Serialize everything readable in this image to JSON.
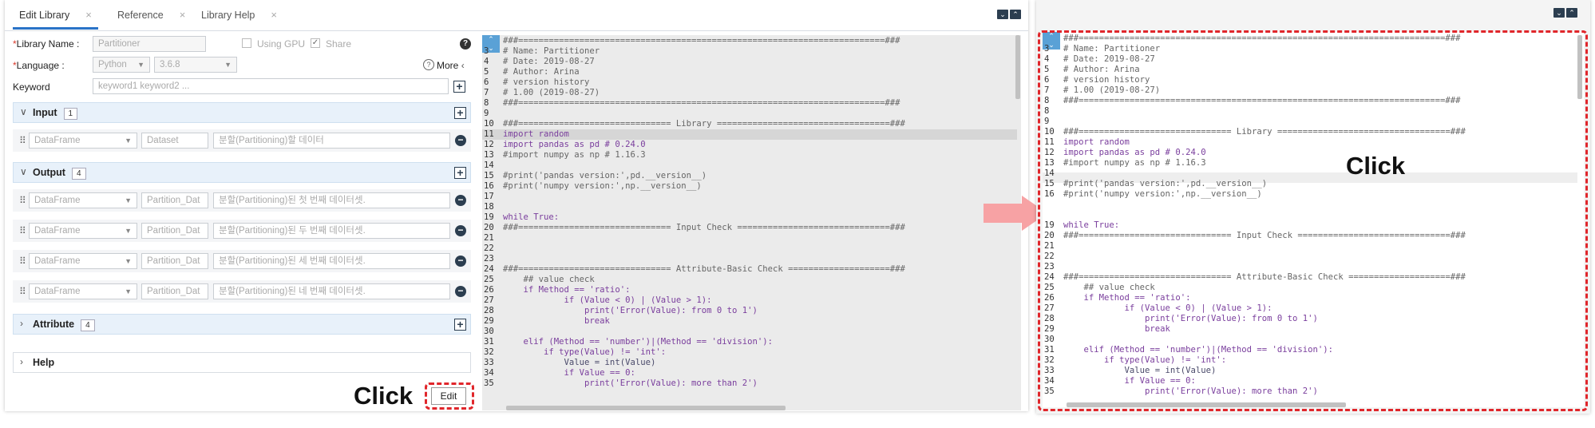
{
  "tabs": [
    {
      "label": "Edit Library"
    },
    {
      "label": "Reference"
    },
    {
      "label": "Library Help"
    }
  ],
  "tab_close": "×",
  "form": {
    "library_name_label": "Library Name :",
    "library_name_placeholder": "Partitioner",
    "using_gpu_label": "Using GPU",
    "share_label": "Share",
    "language_label": "Language :",
    "language_value": "Python",
    "version_value": "3.6.8",
    "more_label": "More",
    "keyword_label": "Keyword",
    "keyword_placeholder": "keyword1 keyword2 ..."
  },
  "sections": {
    "input": {
      "title": "Input",
      "count": "1"
    },
    "output": {
      "title": "Output",
      "count": "4"
    },
    "attribute": {
      "title": "Attribute",
      "count": "4"
    },
    "help": {
      "title": "Help"
    }
  },
  "input_rows": [
    {
      "type": "DataFrame",
      "name": "Dataset",
      "desc": "분할(Partitioning)할 데이터"
    }
  ],
  "output_rows": [
    {
      "type": "DataFrame",
      "name": "Partition_Dat",
      "desc": "분할(Partitioning)된 첫 번째 데이터셋."
    },
    {
      "type": "DataFrame",
      "name": "Partition_Dat",
      "desc": "분할(Partitioning)된 두 번째 데이터셋."
    },
    {
      "type": "DataFrame",
      "name": "Partition_Dat",
      "desc": "분할(Partitioning)된 세 번째 데이터셋."
    },
    {
      "type": "DataFrame",
      "name": "Partition_Dat",
      "desc": "분할(Partitioning)된 네 번째 데이터셋."
    }
  ],
  "edit_button": "Edit",
  "click_left": "Click",
  "click_right": "Click",
  "code_left": [
    {
      "n": "",
      "t": "###========================================================================###"
    },
    {
      "n": "3",
      "t": "# Name: Partitioner"
    },
    {
      "n": "4",
      "t": "# Date: 2019-08-27"
    },
    {
      "n": "5",
      "t": "# Author: Arina"
    },
    {
      "n": "6",
      "t": "# version history"
    },
    {
      "n": "7",
      "t": "# 1.00 (2019-08-27)"
    },
    {
      "n": "8",
      "t": "###========================================================================###"
    },
    {
      "n": "9",
      "t": ""
    },
    {
      "n": "10",
      "t": "###============================== Library ==================================###"
    },
    {
      "n": "11",
      "t": "import random"
    },
    {
      "n": "12",
      "t": "import pandas as pd # 0.24.0"
    },
    {
      "n": "13",
      "t": "#import numpy as np # 1.16.3"
    },
    {
      "n": "14",
      "t": ""
    },
    {
      "n": "15",
      "t": "#print('pandas version:',pd.__version__)"
    },
    {
      "n": "16",
      "t": "#print('numpy version:',np.__version__)"
    },
    {
      "n": "17",
      "t": ""
    },
    {
      "n": "18",
      "t": ""
    },
    {
      "n": "19",
      "t": "while True:"
    },
    {
      "n": "20",
      "t": "###============================== Input Check ==============================###"
    },
    {
      "n": "21",
      "t": ""
    },
    {
      "n": "22",
      "t": ""
    },
    {
      "n": "23",
      "t": ""
    },
    {
      "n": "24",
      "t": "###============================== Attribute-Basic Check ====================###"
    },
    {
      "n": "25",
      "t": "    ## value check"
    },
    {
      "n": "26",
      "t": "    if Method == 'ratio':"
    },
    {
      "n": "27",
      "t": "            if (Value < 0) | (Value > 1):"
    },
    {
      "n": "28",
      "t": "                print('Error(Value): from 0 to 1')"
    },
    {
      "n": "29",
      "t": "                break"
    },
    {
      "n": "30",
      "t": ""
    },
    {
      "n": "31",
      "t": "    elif (Method == 'number')|(Method == 'division'):"
    },
    {
      "n": "32",
      "t": "        if type(Value) != 'int':"
    },
    {
      "n": "33",
      "t": "            Value = int(Value)"
    },
    {
      "n": "34",
      "t": "            if Value == 0:"
    },
    {
      "n": "35",
      "t": "                print('Error(Value): more than 2')"
    }
  ],
  "code_right": [
    {
      "n": "",
      "t": "###========================================================================###"
    },
    {
      "n": "3",
      "t": "# Name: Partitioner"
    },
    {
      "n": "4",
      "t": "# Date: 2019-08-27"
    },
    {
      "n": "5",
      "t": "# Author: Arina"
    },
    {
      "n": "6",
      "t": "# version history"
    },
    {
      "n": "7",
      "t": "# 1.00 (2019-08-27)"
    },
    {
      "n": "8",
      "t": "###========================================================================###"
    },
    {
      "n": "8",
      "t": ""
    },
    {
      "n": "9",
      "t": ""
    },
    {
      "n": "10",
      "t": "###============================== Library ==================================###"
    },
    {
      "n": "11",
      "t": "import random"
    },
    {
      "n": "12",
      "t": "import pandas as pd # 0.24.0"
    },
    {
      "n": "13",
      "t": "#import numpy as np # 1.16.3"
    },
    {
      "n": "14",
      "t": ""
    },
    {
      "n": "15",
      "t": "#print('pandas version:',pd.__version__)"
    },
    {
      "n": "16",
      "t": "#print('numpy version:',np.__version__)"
    },
    {
      "n": "",
      "t": ""
    },
    {
      "n": "",
      "t": ""
    },
    {
      "n": "19",
      "t": "while True:"
    },
    {
      "n": "20",
      "t": "###============================== Input Check ==============================###"
    },
    {
      "n": "21",
      "t": ""
    },
    {
      "n": "22",
      "t": ""
    },
    {
      "n": "23",
      "t": ""
    },
    {
      "n": "24",
      "t": "###============================== Attribute-Basic Check ====================###"
    },
    {
      "n": "25",
      "t": "    ## value check"
    },
    {
      "n": "26",
      "t": "    if Method == 'ratio':"
    },
    {
      "n": "27",
      "t": "            if (Value < 0) | (Value > 1):"
    },
    {
      "n": "28",
      "t": "                print('Error(Value): from 0 to 1')"
    },
    {
      "n": "29",
      "t": "                break"
    },
    {
      "n": "30",
      "t": ""
    },
    {
      "n": "31",
      "t": "    elif (Method == 'number')|(Method == 'division'):"
    },
    {
      "n": "32",
      "t": "        if type(Value) != 'int':"
    },
    {
      "n": "33",
      "t": "            Value = int(Value)"
    },
    {
      "n": "34",
      "t": "            if Value == 0:"
    },
    {
      "n": "35",
      "t": "                print('Error(Value): more than 2')"
    }
  ],
  "colors": {
    "accent": "#2a73c7",
    "annotation": "#e0262b",
    "arrow": "#f7a2a4",
    "section_bg": "#e8f1fa"
  }
}
